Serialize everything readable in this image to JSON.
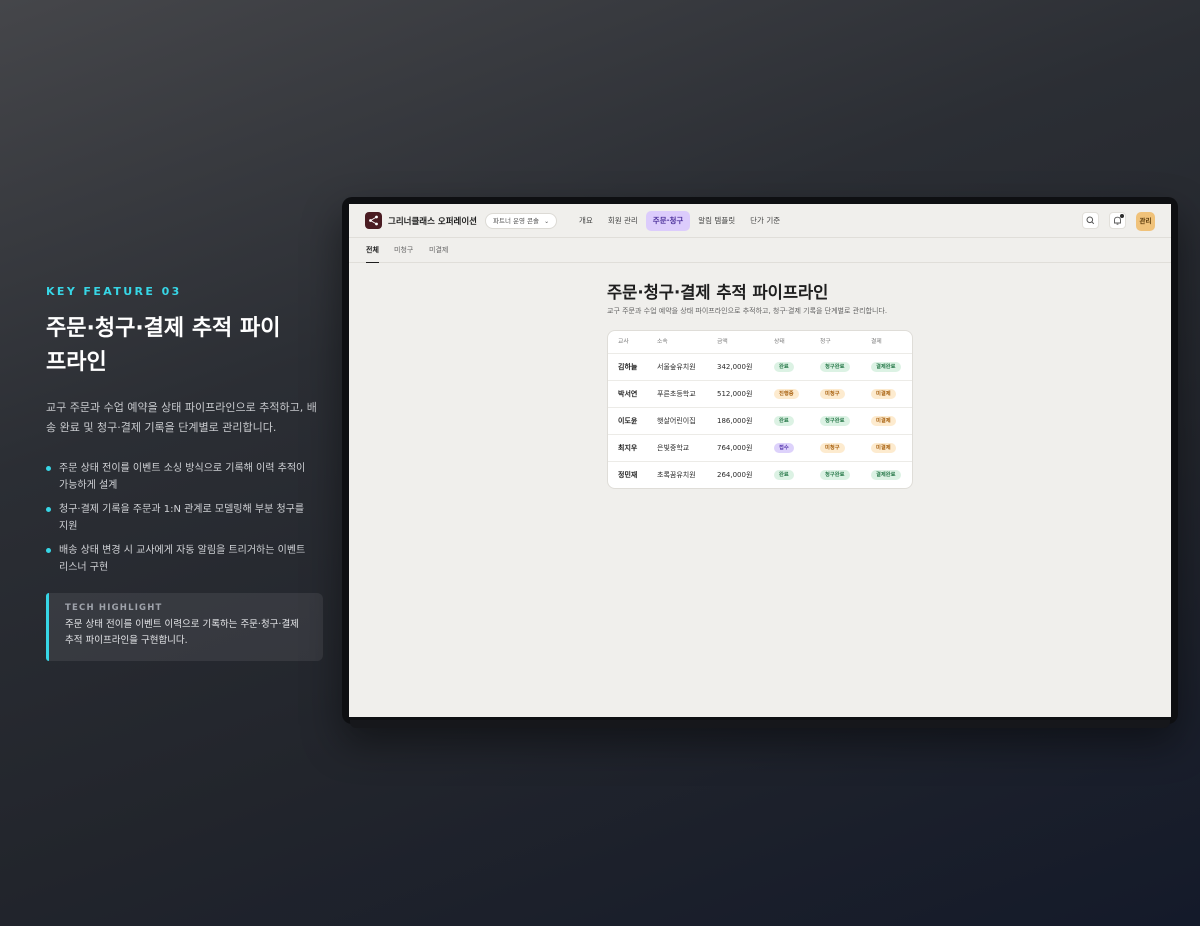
{
  "feature": {
    "kicker": "KEY FEATURE 03",
    "title": "주문·청구·결제 추적 파이프라인",
    "description": "교구 주문과 수업 예약을 상태 파이프라인으로 추적하고, 배송 완료 및 청구·결제 기록을 단계별로 관리합니다.",
    "bullets": [
      "주문 상태 전이를 이벤트 소싱 방식으로 기록해 이력 추적이 가능하게 설계",
      "청구·결제 기록을 주문과 1:N 관계로 모델링해 부분 청구를 지원",
      "배송 상태 변경 시 교사에게 자동 알림을 트리거하는 이벤트 리스너 구현"
    ],
    "highlight_label": "TECH HIGHLIGHT",
    "highlight_text": "주문 상태 전이를 이벤트 이력으로 기록하는 주문·청구·결제 추적 파이프라인을 구현합니다."
  },
  "app": {
    "brand": "그리너클래스 오퍼레이션",
    "logo_icon": "share-nodes-icon",
    "workspace": "파트너 운영 콘솔",
    "nav": [
      "개요",
      "회원 관리",
      "주문·청구",
      "알림 템플릿",
      "단가 기준"
    ],
    "nav_active_index": 2,
    "avatar_label": "관리",
    "subtabs": [
      "전체",
      "미청구",
      "미결제"
    ],
    "subtab_active_index": 0,
    "page_title": "주문·청구·결제 추적 파이프라인",
    "page_subtitle": "교구 주문과 수업 예약을 상태 파이프라인으로 추적하고, 청구·결제 기록을 단계별로 관리합니다.",
    "table": {
      "headers": [
        "교사",
        "소속",
        "금액",
        "상태",
        "청구",
        "결제"
      ],
      "rows": [
        {
          "teacher": "김하늘",
          "org": "서울숲유치원",
          "amount": "342,000원",
          "status": "완료",
          "billing": "청구완료",
          "payment": "결제완료"
        },
        {
          "teacher": "박서연",
          "org": "푸른초등학교",
          "amount": "512,000원",
          "status": "진행중",
          "billing": "미청구",
          "payment": "미결제"
        },
        {
          "teacher": "이도윤",
          "org": "햇살어린이집",
          "amount": "186,000원",
          "status": "완료",
          "billing": "청구완료",
          "payment": "미결제"
        },
        {
          "teacher": "최지우",
          "org": "은빛중학교",
          "amount": "764,000원",
          "status": "접수",
          "billing": "미청구",
          "payment": "미결제"
        },
        {
          "teacher": "정민재",
          "org": "초록꿈유치원",
          "amount": "264,000원",
          "status": "완료",
          "billing": "청구완료",
          "payment": "결제완료"
        }
      ]
    }
  },
  "colors": {
    "accent": "#37d6e6",
    "nav_active_bg": "#dcccfc",
    "badge_green": "#dcf2e4",
    "badge_amber": "#fdebcf",
    "badge_purple": "#ddd2fb"
  }
}
